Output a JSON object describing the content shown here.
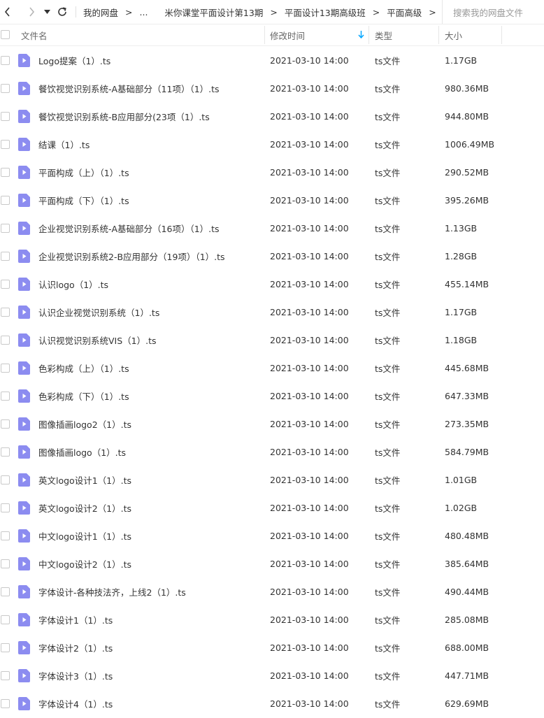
{
  "breadcrumb": {
    "items": [
      "我的网盘",
      "...",
      "米你课堂平面设计第13期",
      "平面设计13期高级班",
      "平面高级"
    ],
    "separator": ">"
  },
  "search": {
    "placeholder": "搜索我的网盘文件"
  },
  "columns": {
    "name": "文件名",
    "modified": "修改时间",
    "type": "类型",
    "size": "大小"
  },
  "colors": {
    "accent": "#06a7ff",
    "file_icon": "#8c8cf0"
  },
  "files": [
    {
      "name": "Logo提案（1）.ts",
      "modified": "2021-03-10 14:00",
      "type": "ts文件",
      "size": "1.17GB"
    },
    {
      "name": "餐饮视觉识别系统-A基础部分（11项）（1）.ts",
      "modified": "2021-03-10 14:00",
      "type": "ts文件",
      "size": "980.36MB"
    },
    {
      "name": "餐饮视觉识别系统-B应用部分(23项（1）.ts",
      "modified": "2021-03-10 14:00",
      "type": "ts文件",
      "size": "944.80MB"
    },
    {
      "name": "结课（1）.ts",
      "modified": "2021-03-10 14:00",
      "type": "ts文件",
      "size": "1006.49MB"
    },
    {
      "name": "平面构成（上）（1）.ts",
      "modified": "2021-03-10 14:00",
      "type": "ts文件",
      "size": "290.52MB"
    },
    {
      "name": "平面构成（下）（1）.ts",
      "modified": "2021-03-10 14:00",
      "type": "ts文件",
      "size": "395.26MB"
    },
    {
      "name": "企业视觉识别系统-A基础部分（16项）（1）.ts",
      "modified": "2021-03-10 14:00",
      "type": "ts文件",
      "size": "1.13GB"
    },
    {
      "name": "企业视觉识别系统2-B应用部分（19项）（1）.ts",
      "modified": "2021-03-10 14:00",
      "type": "ts文件",
      "size": "1.28GB"
    },
    {
      "name": "认识logo（1）.ts",
      "modified": "2021-03-10 14:00",
      "type": "ts文件",
      "size": "455.14MB"
    },
    {
      "name": "认识企业视觉识别系统（1）.ts",
      "modified": "2021-03-10 14:00",
      "type": "ts文件",
      "size": "1.17GB"
    },
    {
      "name": "认识视觉识别系统VIS（1）.ts",
      "modified": "2021-03-10 14:00",
      "type": "ts文件",
      "size": "1.18GB"
    },
    {
      "name": "色彩构成（上）（1）.ts",
      "modified": "2021-03-10 14:00",
      "type": "ts文件",
      "size": "445.68MB"
    },
    {
      "name": "色彩构成（下）（1）.ts",
      "modified": "2021-03-10 14:00",
      "type": "ts文件",
      "size": "647.33MB"
    },
    {
      "name": "图像插画logo2（1）.ts",
      "modified": "2021-03-10 14:00",
      "type": "ts文件",
      "size": "273.35MB"
    },
    {
      "name": "图像插画logo（1）.ts",
      "modified": "2021-03-10 14:00",
      "type": "ts文件",
      "size": "584.79MB"
    },
    {
      "name": "英文logo设计1（1）.ts",
      "modified": "2021-03-10 14:00",
      "type": "ts文件",
      "size": "1.01GB"
    },
    {
      "name": "英文logo设计2（1）.ts",
      "modified": "2021-03-10 14:00",
      "type": "ts文件",
      "size": "1.02GB"
    },
    {
      "name": "中文logo设计1（1）.ts",
      "modified": "2021-03-10 14:00",
      "type": "ts文件",
      "size": "480.48MB"
    },
    {
      "name": "中文logo设计2（1）.ts",
      "modified": "2021-03-10 14:00",
      "type": "ts文件",
      "size": "385.64MB"
    },
    {
      "name": "字体设计-各种技法齐，上线2（1）.ts",
      "modified": "2021-03-10 14:00",
      "type": "ts文件",
      "size": "490.44MB"
    },
    {
      "name": "字体设计1（1）.ts",
      "modified": "2021-03-10 14:00",
      "type": "ts文件",
      "size": "285.08MB"
    },
    {
      "name": "字体设计2（1）.ts",
      "modified": "2021-03-10 14:00",
      "type": "ts文件",
      "size": "688.00MB"
    },
    {
      "name": "字体设计3（1）.ts",
      "modified": "2021-03-10 14:00",
      "type": "ts文件",
      "size": "447.71MB"
    },
    {
      "name": "字体设计4（1）.ts",
      "modified": "2021-03-10 14:00",
      "type": "ts文件",
      "size": "629.69MB"
    }
  ]
}
